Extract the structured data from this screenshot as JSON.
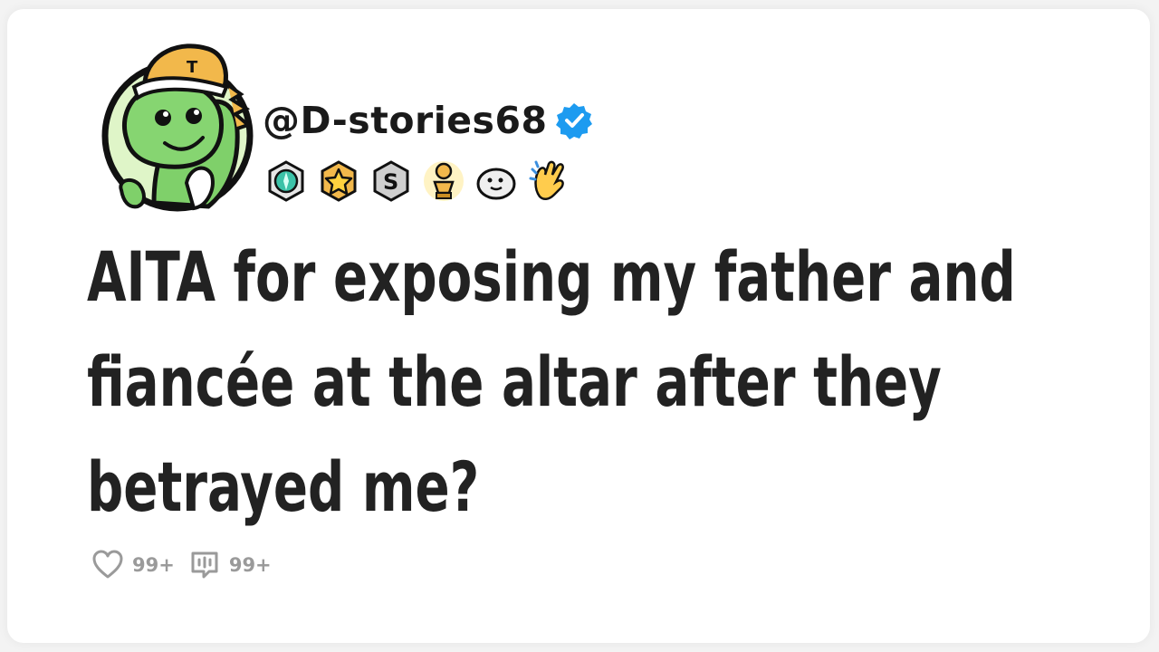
{
  "post": {
    "author": {
      "handle": "@D-stories68",
      "verified": true,
      "avatar_icon": "dinosaur-mascot-icon",
      "badges": [
        {
          "name": "crystal-award-icon"
        },
        {
          "name": "star-award-icon"
        },
        {
          "name": "silver-s-award-icon"
        },
        {
          "name": "gold-trophy-award-icon"
        },
        {
          "name": "seal-award-icon"
        },
        {
          "name": "clap-hands-award-icon"
        }
      ]
    },
    "title": "AITA for exposing my father and fiancée at the altar after they betrayed me?",
    "stats": {
      "likes": "99+",
      "comments": "99+"
    }
  },
  "colors": {
    "verified_blue": "#1d9bf0",
    "avatar_ring": "#111111",
    "avatar_bg": "#dff5c8",
    "dino_green": "#7fd06a",
    "stat_gray": "#9a9a9a"
  }
}
